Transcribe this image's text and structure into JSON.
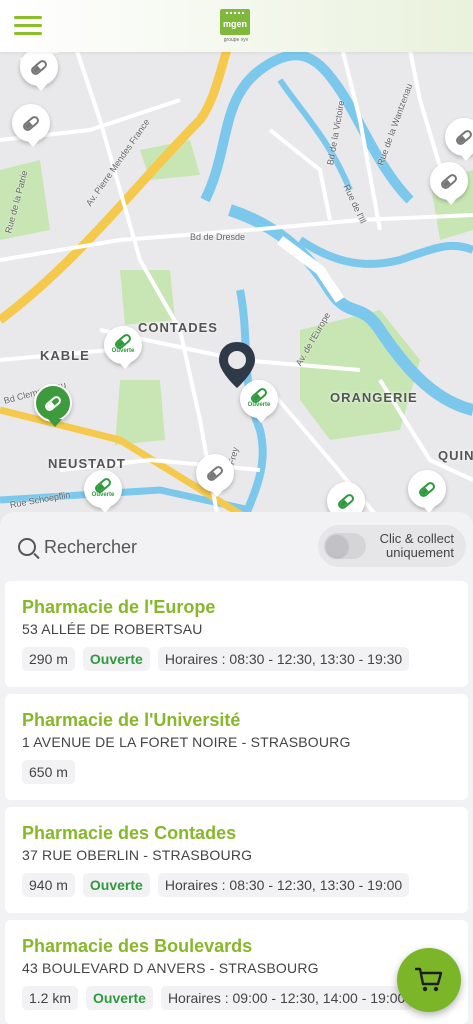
{
  "header": {
    "menu_icon": "hamburger-menu-icon",
    "logo_text": "mgen",
    "logo_sub": "groupe vyv"
  },
  "map": {
    "districts": [
      "CONTADES",
      "KABLE",
      "ORANGERIE",
      "NEUSTADT",
      "QUIN"
    ],
    "streets": [
      "Av. Pierre Mendes France",
      "Bd de Dresde",
      "Rue de la Wantzenau",
      "Av. de l'Europe",
      "Bd de la Victoire",
      "Rue de la Patrie",
      "Rue Schoepflin",
      "Bd Clemenceau",
      "Rue de l'Ill",
      "Rue Frey"
    ],
    "open_label": "Ouverte",
    "pin_icon": "pill-capsule-icon",
    "location_icon": "location-pin-icon"
  },
  "search": {
    "placeholder": "Rechercher",
    "toggle_label": "Clic & collect uniquement",
    "toggle_on": false
  },
  "pharmacies": [
    {
      "name": "Pharmacie de l'Europe",
      "address": "53 ALLÉE DE ROBERTSAU",
      "distance": "290 m",
      "status": "Ouverte",
      "hours": "Horaires : 08:30 - 12:30, 13:30 - 19:30"
    },
    {
      "name": "Pharmacie de l'Université",
      "address": "1 AVENUE DE LA FORET NOIRE - STRASBOURG",
      "distance": "650 m",
      "status": "",
      "hours": ""
    },
    {
      "name": "Pharmacie des Contades",
      "address": "37 RUE OBERLIN - STRASBOURG",
      "distance": "940 m",
      "status": "Ouverte",
      "hours": "Horaires : 08:30 - 12:30, 13:30 - 19:00"
    },
    {
      "name": "Pharmacie des Boulevards",
      "address": "43 BOULEVARD D ANVERS - STRASBOURG",
      "distance": "1.2 km",
      "status": "Ouverte",
      "hours": "Horaires : 09:00 - 12:30, 14:00 - 19:00"
    }
  ],
  "cart": {
    "icon": "shopping-cart-icon"
  },
  "colors": {
    "brand_green": "#86b82a",
    "open_green": "#2e9a3e",
    "river": "#7cc8ec",
    "park": "#c8e6b4"
  }
}
